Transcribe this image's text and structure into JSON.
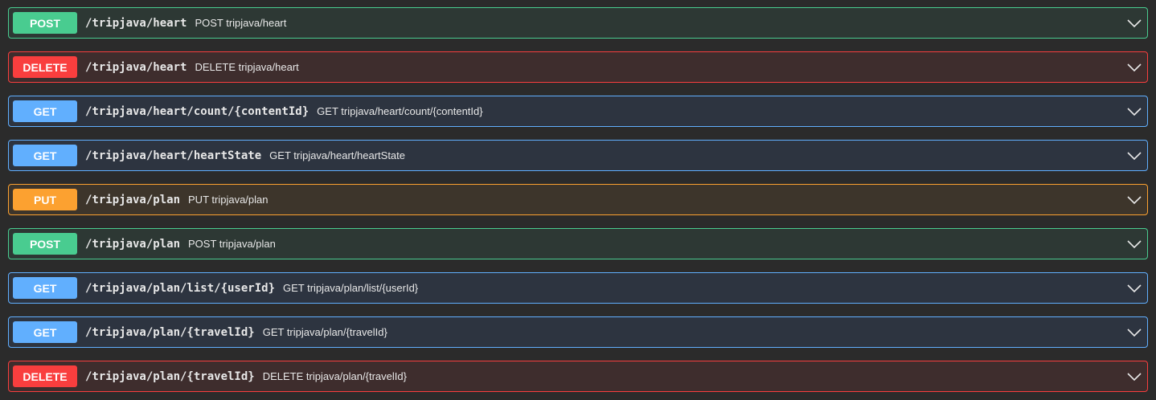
{
  "operations": [
    {
      "method": "POST",
      "kind": "post",
      "path": "/tripjava/heart",
      "summary": "POST tripjava/heart",
      "chevron_icon": "chevron-down-icon"
    },
    {
      "method": "DELETE",
      "kind": "delete",
      "path": "/tripjava/heart",
      "summary": "DELETE tripjava/heart",
      "chevron_icon": "chevron-down-icon"
    },
    {
      "method": "GET",
      "kind": "get",
      "path": "/tripjava/heart/count/{contentId}",
      "summary": "GET tripjava/heart/count/{contentId}",
      "chevron_icon": "chevron-down-icon"
    },
    {
      "method": "GET",
      "kind": "get",
      "path": "/tripjava/heart/heartState",
      "summary": "GET tripjava/heart/heartState",
      "chevron_icon": "chevron-down-icon"
    },
    {
      "method": "PUT",
      "kind": "put",
      "path": "/tripjava/plan",
      "summary": "PUT tripjava/plan",
      "chevron_icon": "chevron-down-icon"
    },
    {
      "method": "POST",
      "kind": "post",
      "path": "/tripjava/plan",
      "summary": "POST tripjava/plan",
      "chevron_icon": "chevron-down-icon"
    },
    {
      "method": "GET",
      "kind": "get",
      "path": "/tripjava/plan/list/{userId}",
      "summary": "GET tripjava/plan/list/{userId}",
      "chevron_icon": "chevron-down-icon"
    },
    {
      "method": "GET",
      "kind": "get",
      "path": "/tripjava/plan/{travelId}",
      "summary": "GET tripjava/plan/{travelId}",
      "chevron_icon": "chevron-down-icon"
    },
    {
      "method": "DELETE",
      "kind": "delete",
      "path": "/tripjava/plan/{travelId}",
      "summary": "DELETE tripjava/plan/{travelId}",
      "chevron_icon": "chevron-down-icon"
    }
  ],
  "colors": {
    "post": "#49cc90",
    "delete": "#f93e3e",
    "get": "#61affe",
    "put": "#fca130",
    "background": "#2b2b2b",
    "text": "#e8e8e8"
  }
}
